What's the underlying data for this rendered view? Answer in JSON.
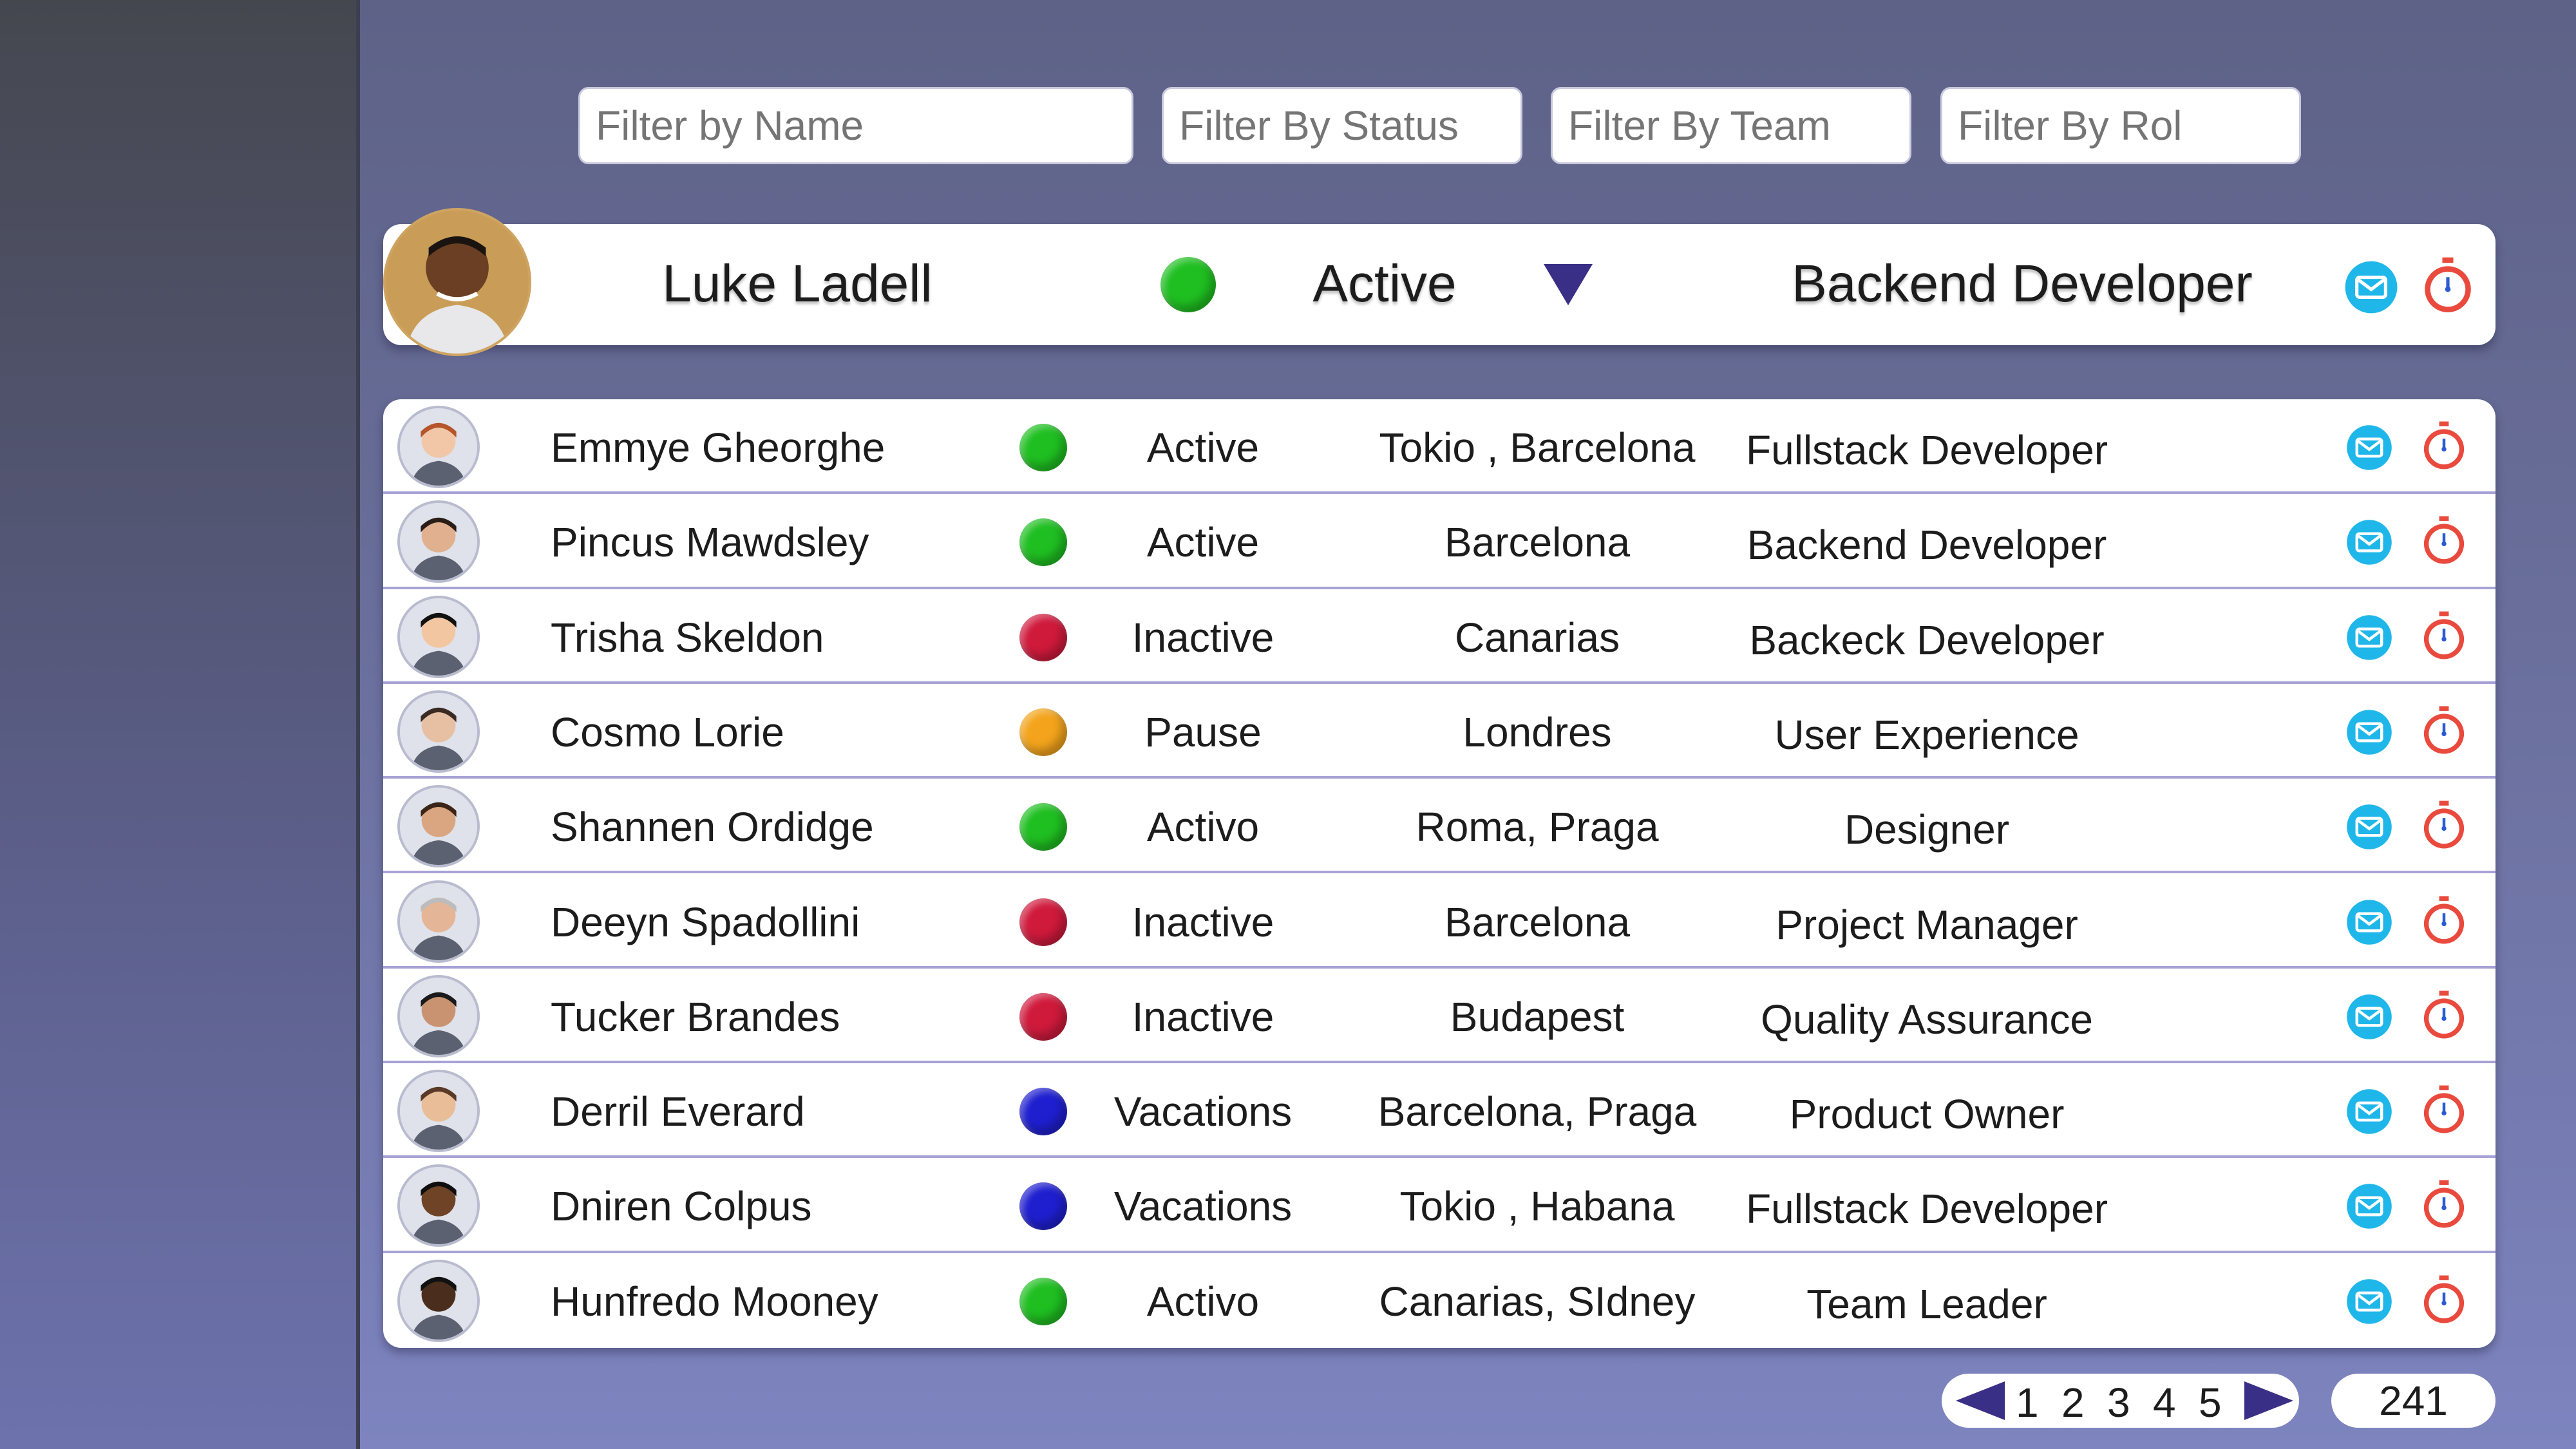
{
  "filters": {
    "name_placeholder": "Filter by Name",
    "status_placeholder": "Filter By Status",
    "team_placeholder": "Filter By Team",
    "role_placeholder": "Filter By Rol"
  },
  "selected": {
    "name": "Luke Ladell",
    "status": "Active",
    "status_color": "#1fbf21",
    "role": "Backend Developer"
  },
  "colors": {
    "accent": "#5a4fa6",
    "mail": "#1fb7ea",
    "timer": "#e94a3d",
    "active": "#1fbf21",
    "inactive": "#d01a3c",
    "pause": "#f3a41c",
    "vacations": "#1f1fd0"
  },
  "icons": {
    "mail": "mail-icon",
    "timer": "stopwatch-icon",
    "dropdown": "triangle-down-icon",
    "prev": "arrow-left-icon",
    "next": "arrow-right-icon"
  },
  "rows": [
    {
      "name": "Emmye Gheorghe",
      "status": "Active",
      "status_color": "#1fbf21",
      "team": "Tokio , Barcelona",
      "role": "Fullstack Developer"
    },
    {
      "name": "Pincus Mawdsley",
      "status": "Active",
      "status_color": "#1fbf21",
      "team": "Barcelona",
      "role": "Backend Developer"
    },
    {
      "name": "Trisha Skeldon",
      "status": "Inactive",
      "status_color": "#d01a3c",
      "team": "Canarias",
      "role": "Backeck Developer"
    },
    {
      "name": "Cosmo Lorie",
      "status": "Pause",
      "status_color": "#f3a41c",
      "team": "Londres",
      "role": "User Experience"
    },
    {
      "name": "Shannen Ordidge",
      "status": "Activo",
      "status_color": "#1fbf21",
      "team": "Roma, Praga",
      "role": "Designer"
    },
    {
      "name": "Deeyn Spadollini",
      "status": "Inactive",
      "status_color": "#d01a3c",
      "team": "Barcelona",
      "role": "Project Manager"
    },
    {
      "name": "Tucker Brandes",
      "status": "Inactive",
      "status_color": "#d01a3c",
      "team": "Budapest",
      "role": "Quality Assurance"
    },
    {
      "name": "Derril Everard",
      "status": "Vacations",
      "status_color": "#1f1fd0",
      "team": "Barcelona, Praga",
      "role": "Product Owner"
    },
    {
      "name": "Dniren Colpus",
      "status": "Vacations",
      "status_color": "#1f1fd0",
      "team": "Tokio , Habana",
      "role": "Fullstack Developer"
    },
    {
      "name": "Hunfredo Mooney",
      "status": "Activo",
      "status_color": "#1fbf21",
      "team": "Canarias, SIdney",
      "role": "Team Leader"
    }
  ],
  "pagination": {
    "pages": [
      "1",
      "2",
      "3",
      "4",
      "5"
    ],
    "total": "241"
  }
}
